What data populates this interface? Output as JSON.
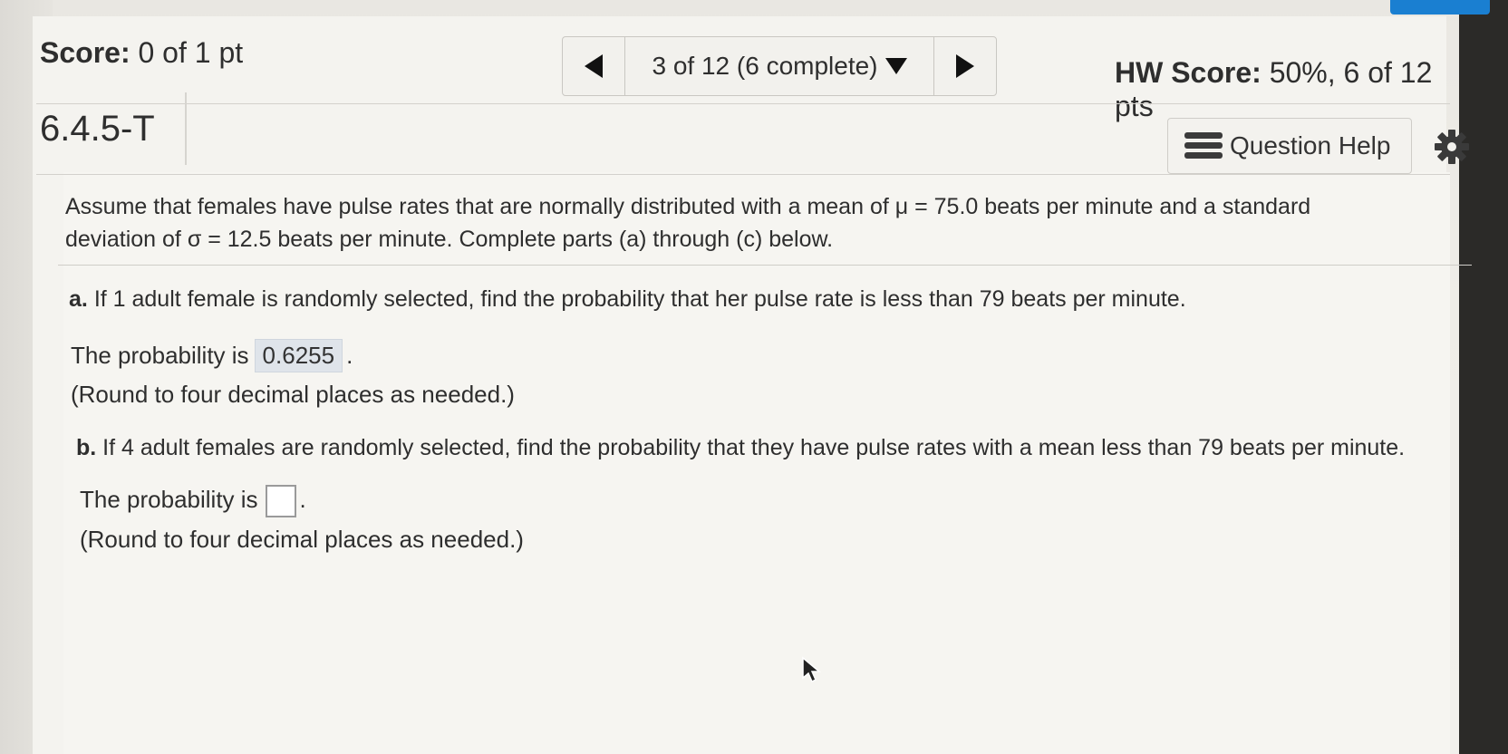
{
  "header": {
    "score_label": "Score:",
    "score_value": "0 of 1 pt",
    "nav_position": "3 of 12 (6 complete)",
    "hw_label": "HW Score:",
    "hw_value": "50%, 6 of 12 pts"
  },
  "question": {
    "id": "6.4.5-T",
    "help_label": "Question Help",
    "intro": "Assume that females have pulse rates that are normally distributed with a mean of μ = 75.0 beats per minute and a standard deviation of σ = 12.5 beats per minute. Complete parts (a) through (c) below.",
    "part_a": {
      "letter": "a.",
      "text": "If 1 adult female is randomly selected, find the probability that her pulse rate is less than 79 beats per minute.",
      "answer_prefix": "The probability is",
      "answer_value": "0.6255",
      "answer_suffix": ".",
      "note": "(Round to four decimal places as needed.)"
    },
    "part_b": {
      "letter": "b.",
      "text": "If 4 adult females are randomly selected, find the probability that they have pulse rates with a mean less than 79 beats per minute.",
      "answer_prefix": "The probability is",
      "answer_value": "",
      "answer_suffix": ".",
      "note": "(Round to four decimal places as needed.)"
    }
  },
  "icons": {
    "prev": "left-triangle-icon",
    "next": "right-triangle-icon",
    "dropdown": "caret-down-icon",
    "help": "list-icon",
    "settings": "gear-icon"
  }
}
